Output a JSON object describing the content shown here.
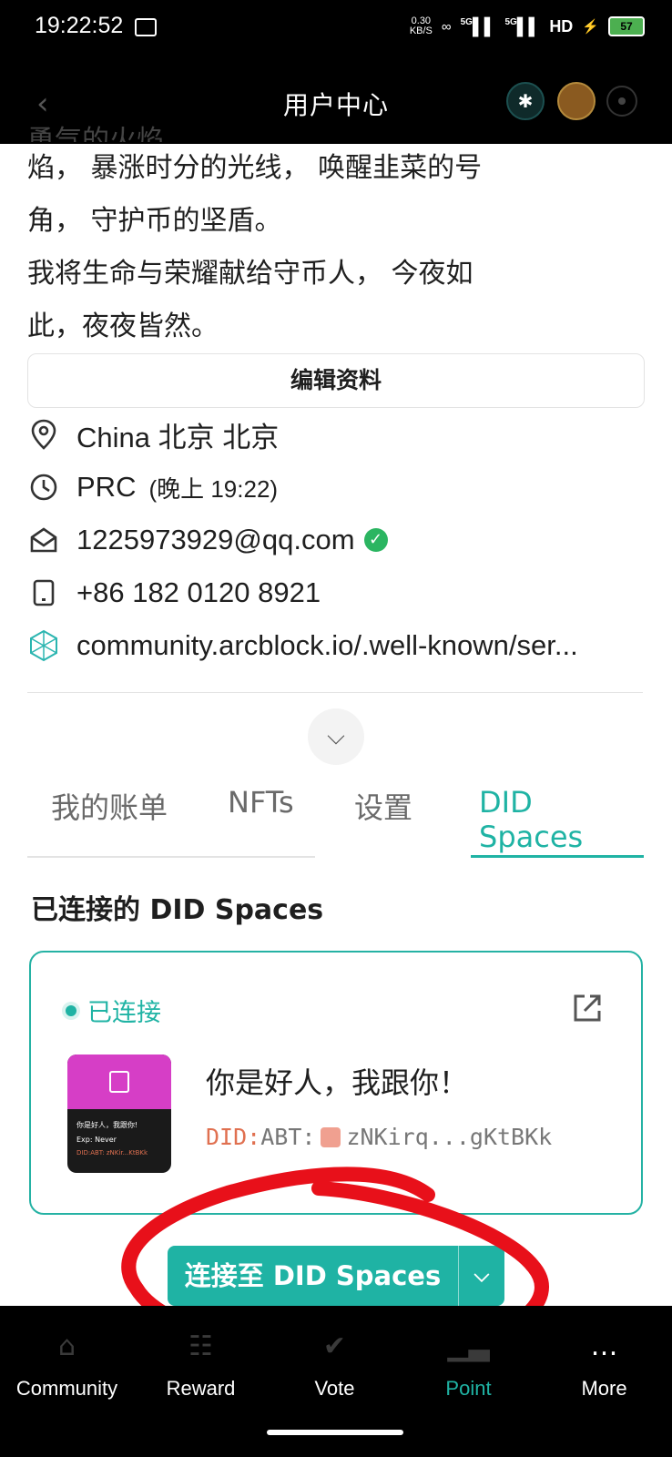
{
  "status_bar": {
    "time": "19:22:52",
    "net_speed_value": "0.30",
    "net_speed_unit": "KB/S",
    "signal1": "5G",
    "signal2": "5G",
    "hd": "HD",
    "battery": "57"
  },
  "header": {
    "title": "用户中心"
  },
  "bio": {
    "line0": "勇气的火焰，",
    "line1": "焰， 暴涨时分的光线， 唤醒韭菜的号",
    "line2": "角， 守护币的坚盾。",
    "line3": "我将生命与荣耀献给守币人， 今夜如",
    "line4": "此，夜夜皆然。"
  },
  "edit_profile_label": "编辑资料",
  "info": {
    "location": "China 北京 北京",
    "timezone": "PRC",
    "local_time": "(晚上 19:22)",
    "email": "1225973929@qq.com",
    "phone": "+86 182 0120 8921",
    "did_service": "community.arcblock.io/.well-known/ser..."
  },
  "tabs": [
    {
      "label": "我的账单"
    },
    {
      "label": "NFTs"
    },
    {
      "label": "设置"
    },
    {
      "label": "DID Spaces"
    }
  ],
  "section_title": "已连接的 DID Spaces",
  "space_card": {
    "status": "已连接",
    "name": "你是好人，我跟你！",
    "did_prefix": "DID:",
    "did_value": "ABT:",
    "did_short": "zNKirq...gKtBKk",
    "thumb_line1": "你是好人，我跟你!",
    "thumb_exp_label": "Exp:",
    "thumb_exp_value": "Never",
    "thumb_did": "DID:ABT: zNKir...KtBKk"
  },
  "connect_button": {
    "label": "连接至 DID Spaces"
  },
  "bottom_nav": [
    {
      "label": "Community",
      "icon": "home-icon"
    },
    {
      "label": "Reward",
      "icon": "gift-icon"
    },
    {
      "label": "Vote",
      "icon": "vote-icon"
    },
    {
      "label": "Point",
      "icon": "chart-icon"
    },
    {
      "label": "More",
      "icon": "more-icon"
    }
  ],
  "colors": {
    "accent": "#1fb3a4",
    "annotation": "#e8101a"
  }
}
